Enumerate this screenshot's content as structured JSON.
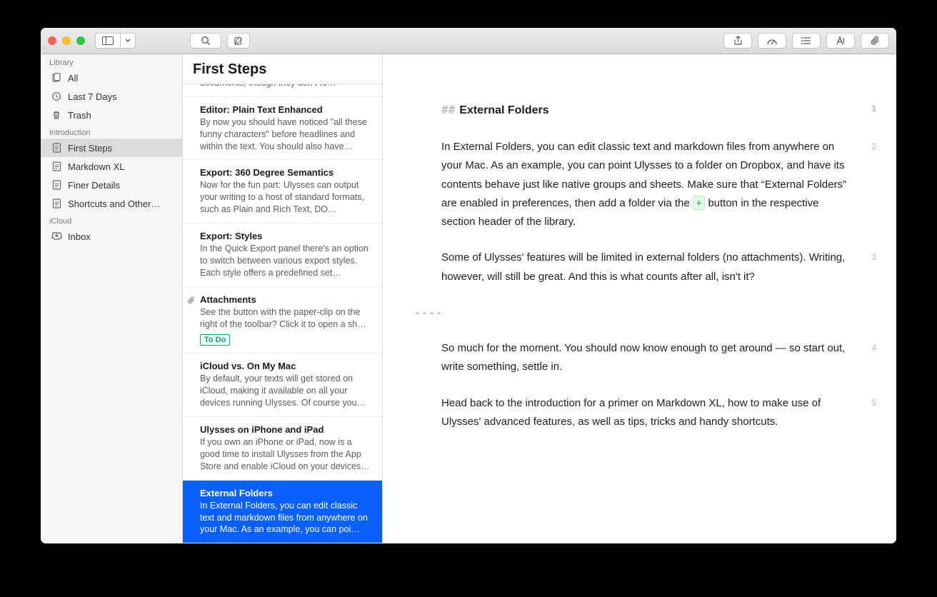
{
  "sidebar": {
    "sections": [
      {
        "label": "Library",
        "items": [
          {
            "icon": "stack",
            "label": "All"
          },
          {
            "icon": "clock",
            "label": "Last 7 Days"
          },
          {
            "icon": "trash",
            "label": "Trash"
          }
        ]
      },
      {
        "label": "Introduction",
        "items": [
          {
            "icon": "sheet",
            "label": "First Steps",
            "selected": true
          },
          {
            "icon": "sheet",
            "label": "Markdown XL"
          },
          {
            "icon": "sheet",
            "label": "Finer Details"
          },
          {
            "icon": "sheet",
            "label": "Shortcuts and Other…"
          }
        ]
      },
      {
        "label": "iCloud",
        "items": [
          {
            "icon": "inbox",
            "label": "Inbox"
          }
        ]
      }
    ]
  },
  "sheetlist": {
    "header": "First Steps",
    "sheets": [
      {
        "title": "",
        "preview": "Sheets are somewhat equivalent to classic documents, though they don't re…",
        "truncated": true
      },
      {
        "title": "Editor: Plain Text Enhanced",
        "preview": "By now you should have noticed \"all these funny characters\" before headlines and within the text. You should also have…"
      },
      {
        "title": "Export: 360 Degree Semantics",
        "preview": "Now for the fun part: Ulysses can output your writing to a host of standard formats, such as Plain and Rich Text, DO…"
      },
      {
        "title": "Export: Styles",
        "preview": "In the Quick Export panel there's an option to switch between various export styles. Each style offers a predefined set…"
      },
      {
        "title": "Attachments",
        "preview": "See the button with the paper-clip on the right of the toolbar? Click it to open a sh…",
        "clip": true,
        "tag": "To Do",
        "truncated": true
      },
      {
        "title": "iCloud vs. On My Mac",
        "preview": "By default, your texts will get stored on iCloud, making it available on all your devices running Ulysses. Of course you…"
      },
      {
        "title": "Ulysses on iPhone and iPad",
        "preview": "If you own an iPhone or iPad, now is a good time to install Ulysses from the App Store and enable iCloud on your devices…"
      },
      {
        "title": "External Folders",
        "preview": "In External Folders, you can edit classic text and markdown files from anywhere on your Mac. As an example, you can poi…",
        "selected": true
      }
    ]
  },
  "editor": {
    "hash": "##",
    "heading": "External Folders",
    "plus_key": "+",
    "p1a": "In External Folders, you can edit classic text and markdown files from anywhere on your Mac. As an example, you can point Ulysses to a folder on Dropbox, and have its contents behave just like native groups and sheets. Make sure that “External Folders” are enabled in preferences, then add a folder via the ",
    "p1b": " button in the respective section header of the library.",
    "p2": "Some of Ulysses' features will be limited in external folders (no attachments). Writing, however, will still be great. And this is what counts after all, isn't it?",
    "hr": "----",
    "p3": "So much for the moment. You should now know enough to get around — so start out, write something, settle in.",
    "p4": "Head back to the introduction for a primer on Markdown XL, how to make use of Ulysses' advanced features, as well as tips, tricks and handy shortcuts.",
    "nums": [
      "1",
      "2",
      "3",
      "4",
      "5"
    ]
  }
}
